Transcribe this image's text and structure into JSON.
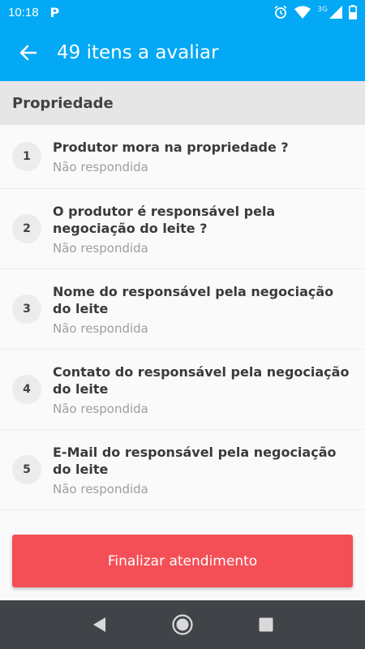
{
  "status_bar": {
    "time": "10:18",
    "notification_letter": "P",
    "network_label": "3G",
    "icons": [
      "alarm-icon",
      "wifi-icon",
      "signal-icon",
      "battery-icon"
    ]
  },
  "app_bar": {
    "title": "49 itens a avaliar",
    "back_icon": "arrow-left-icon",
    "color": "#03a9f4"
  },
  "section": {
    "title": "Propriedade"
  },
  "items": [
    {
      "number": "1",
      "question": "Produtor mora na propriedade ?",
      "status": "Não respondida"
    },
    {
      "number": "2",
      "question": "O produtor é responsável pela negociação do leite ?",
      "status": "Não respondida"
    },
    {
      "number": "3",
      "question": "Nome do responsável pela negociação do leite",
      "status": "Não respondida"
    },
    {
      "number": "4",
      "question": "Contato do responsável pela negociação do leite",
      "status": "Não respondida"
    },
    {
      "number": "5",
      "question": "E-Mail do responsável pela negociação do leite",
      "status": "Não respondida"
    }
  ],
  "finish_button": {
    "label": "Finalizar atendimento",
    "color": "#f44f56"
  },
  "nav_bar": {
    "buttons": [
      "back-triangle-icon",
      "home-circle-icon",
      "recents-square-icon"
    ]
  }
}
